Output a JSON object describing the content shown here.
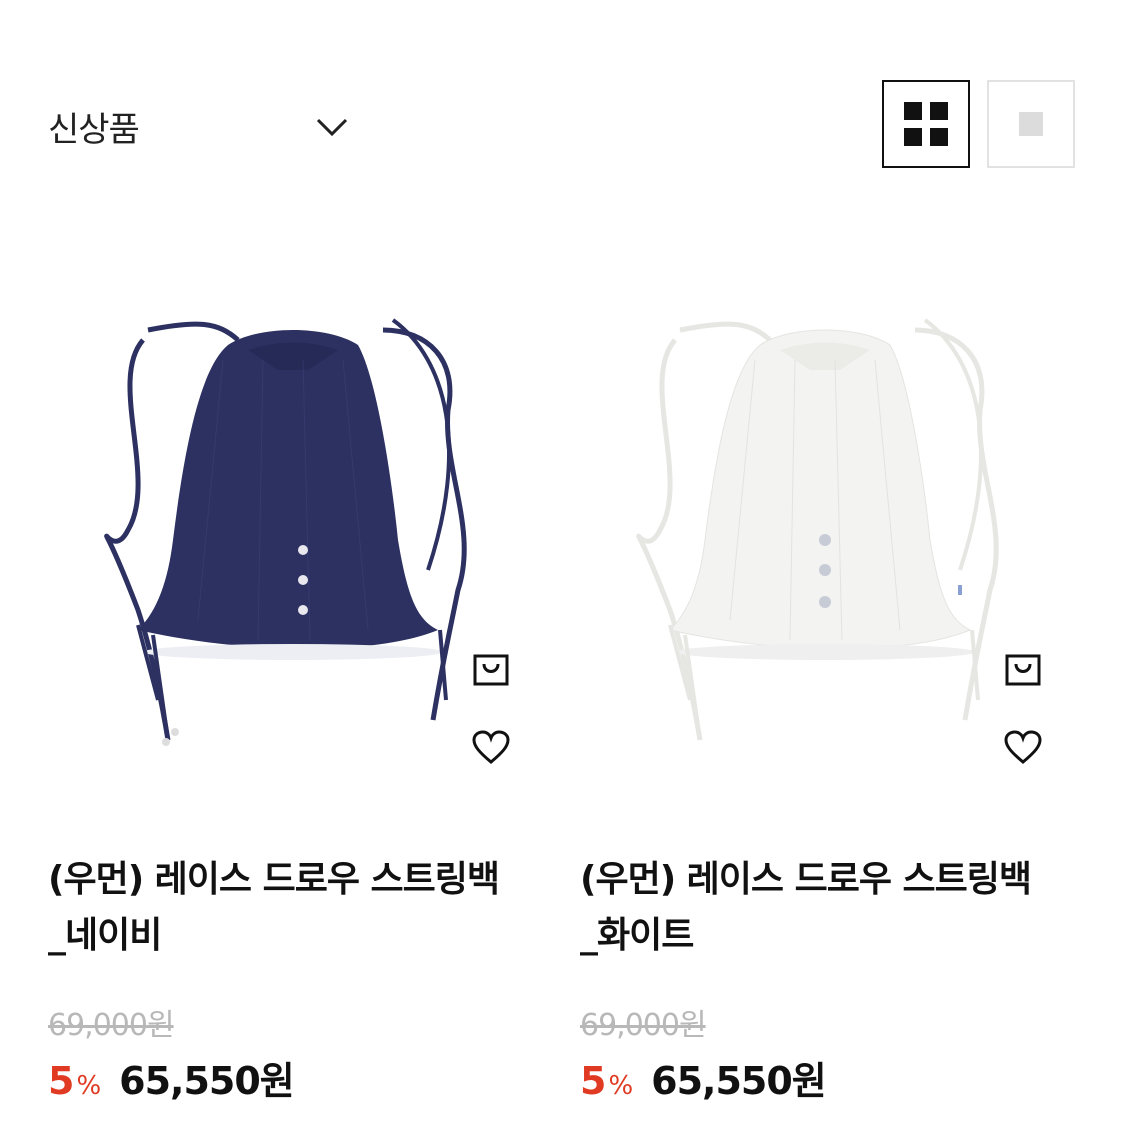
{
  "toolbar": {
    "sort_label": "신상품",
    "icons": {
      "sort_toggle": "chevron-down-icon",
      "grid_view": "grid-view-icon",
      "single_view": "single-view-icon"
    }
  },
  "products": [
    {
      "name_line1": "(우먼) 레이스 드로우 스트링백",
      "name_line2": "_네이비",
      "original_price": "69,000원",
      "discount_rate": "5",
      "discount_unit": "%",
      "sale_price": "65,550원",
      "color": "#2c3161"
    },
    {
      "name_line1": "(우먼) 레이스 드로우 스트링백",
      "name_line2": "_화이트",
      "original_price": "69,000원",
      "discount_rate": "5",
      "discount_unit": "%",
      "sale_price": "65,550원",
      "color": "#f3f3f1"
    }
  ],
  "colors": {
    "accent_discount": "#e03a22",
    "text_primary": "#111111",
    "text_muted": "#b8b8b8"
  }
}
